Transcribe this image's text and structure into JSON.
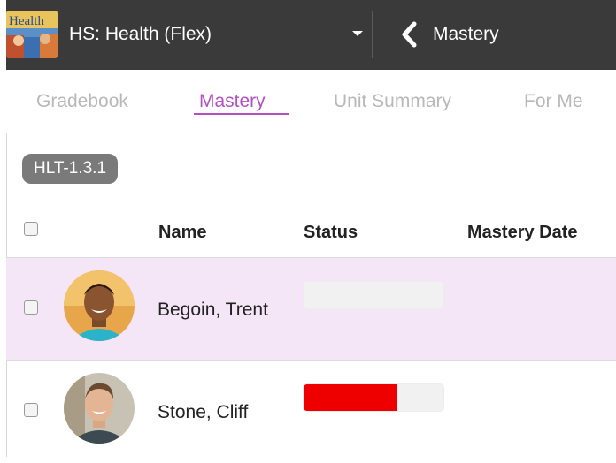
{
  "header": {
    "course_title": "HS: Health (Flex)",
    "back_label": "Mastery",
    "thumbnail_text": "Health"
  },
  "tabs": [
    {
      "label": "Gradebook",
      "active": false
    },
    {
      "label": "Mastery",
      "active": true
    },
    {
      "label": "Unit Summary",
      "active": false
    },
    {
      "label": "For Me",
      "active": false
    }
  ],
  "standard_chip": "HLT-1.3.1",
  "table": {
    "columns": [
      "Name",
      "Status",
      "Mastery Date"
    ],
    "rows": [
      {
        "name": "Begoin, Trent",
        "status_fraction": 0.0,
        "mastery_date": "",
        "selected": true
      },
      {
        "name": "Stone, Cliff",
        "status_fraction": 0.67,
        "mastery_date": "",
        "selected": false
      }
    ]
  },
  "colors": {
    "header_bg": "#3a3a3a",
    "accent": "#b44fc4",
    "selected_row": "#f5e6f7",
    "status_bar_fill": "#ee0000"
  }
}
